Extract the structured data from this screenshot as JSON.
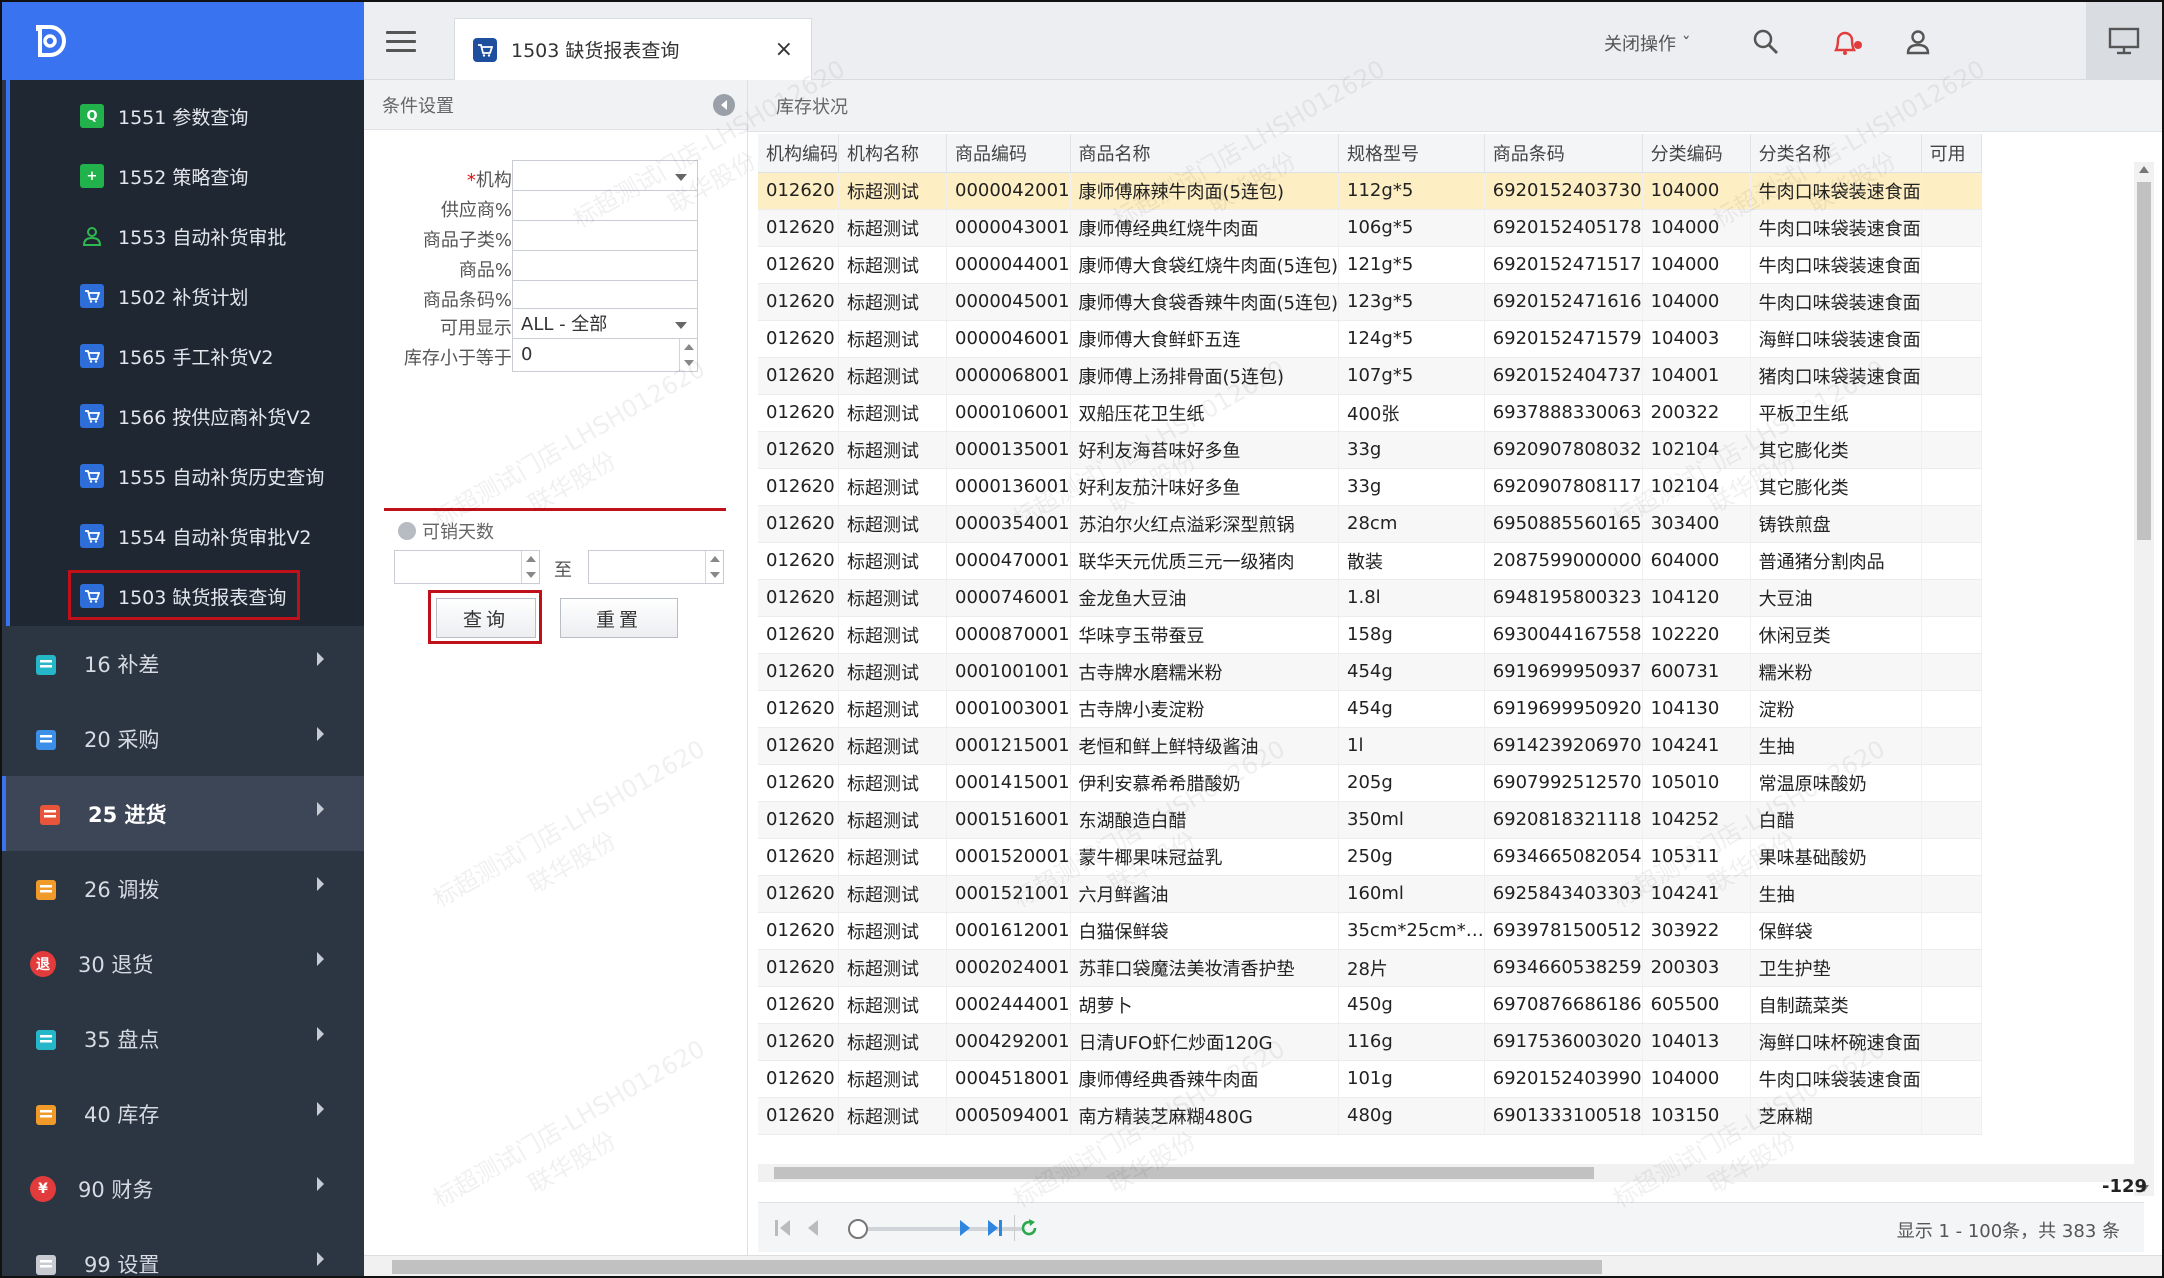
{
  "sidebar": {
    "sub_items": [
      {
        "label": "1551 参数查询",
        "icon": "search-icon",
        "color": "green"
      },
      {
        "label": "1552 策略查询",
        "icon": "plus-icon",
        "color": "green"
      },
      {
        "label": "1553 自动补货审批",
        "icon": "person-icon",
        "color": "green-outline"
      },
      {
        "label": "1502 补货计划",
        "icon": "cart-icon",
        "color": "blue"
      },
      {
        "label": "1565 手工补货V2",
        "icon": "cart-icon",
        "color": "blue"
      },
      {
        "label": "1566 按供应商补货V2",
        "icon": "cart-icon",
        "color": "blue"
      },
      {
        "label": "1555 自动补货历史查询",
        "icon": "cart-icon",
        "color": "blue"
      },
      {
        "label": "1554 自动补货审批V2",
        "icon": "cart-icon",
        "color": "blue"
      },
      {
        "label": "1503 缺货报表查询",
        "icon": "cart-icon",
        "color": "blue",
        "active": true
      }
    ],
    "main_items": [
      {
        "label": "16 补差",
        "icon": "clipboard-icon",
        "color": "#25b6c8"
      },
      {
        "label": "20 采购",
        "icon": "basket-icon",
        "color": "#3b8fe8"
      },
      {
        "label": "25 进货",
        "icon": "truck-icon",
        "color": "#e8553b",
        "active": true
      },
      {
        "label": "26 调拨",
        "icon": "transfer-icon",
        "color": "#f09a2a"
      },
      {
        "label": "30 退货",
        "icon": "return-icon",
        "color": "#e23b3b",
        "glyph": "退"
      },
      {
        "label": "35 盘点",
        "icon": "checklist-icon",
        "color": "#25b6c8"
      },
      {
        "label": "40 库存",
        "icon": "warehouse-icon",
        "color": "#f09a2a"
      },
      {
        "label": "90 财务",
        "icon": "finance-icon",
        "color": "#e23b3b",
        "glyph": "¥"
      },
      {
        "label": "99 设置",
        "icon": "gear-icon",
        "color": "#c8ccd2"
      }
    ]
  },
  "topbar": {
    "tab_label": "1503 缺货报表查询",
    "tab_close": "×",
    "close_ops": "关闭操作 ˇ"
  },
  "conditions": {
    "header": "条件设置",
    "fields": [
      {
        "label": "机构:",
        "required": true,
        "value": "",
        "type": "dropdown"
      },
      {
        "label": "供应商%:",
        "value": "",
        "type": "text"
      },
      {
        "label": "商品子类%:",
        "value": "",
        "type": "text"
      },
      {
        "label": "商品%:",
        "value": "",
        "type": "text"
      },
      {
        "label": "商品条码%:",
        "value": "",
        "type": "text"
      },
      {
        "label": "可用显示:",
        "value": "ALL - 全部",
        "type": "dropdown"
      },
      {
        "label": "库存小于等于:",
        "value": "0",
        "type": "spinner"
      }
    ],
    "required_mark": "*",
    "days_label": "可销天数",
    "to_label": "至",
    "query_button": "查询",
    "reset_button": "重置"
  },
  "stock": {
    "header": "库存状况",
    "columns": [
      "机构编码",
      "机构名称",
      "商品编码",
      "商品名称",
      "规格型号",
      "商品条码",
      "分类编码",
      "分类名称",
      "可用"
    ],
    "rows": [
      [
        "012620",
        "标超测试",
        "0000042001",
        "康师傅麻辣牛肉面(5连包)",
        "112g*5",
        "6920152403730",
        "104000",
        "牛肉口味袋装速食面"
      ],
      [
        "012620",
        "标超测试",
        "0000043001",
        "康师傅经典红烧牛肉面",
        "106g*5",
        "6920152405178",
        "104000",
        "牛肉口味袋装速食面"
      ],
      [
        "012620",
        "标超测试",
        "0000044001",
        "康师傅大食袋红烧牛肉面(5连包)",
        "121g*5",
        "6920152471517",
        "104000",
        "牛肉口味袋装速食面"
      ],
      [
        "012620",
        "标超测试",
        "0000045001",
        "康师傅大食袋香辣牛肉面(5连包)",
        "123g*5",
        "6920152471616",
        "104000",
        "牛肉口味袋装速食面"
      ],
      [
        "012620",
        "标超测试",
        "0000046001",
        "康师傅大食鲜虾五连",
        "124g*5",
        "6920152471579",
        "104003",
        "海鲜口味袋装速食面"
      ],
      [
        "012620",
        "标超测试",
        "0000068001",
        "康师傅上汤排骨面(5连包)",
        "107g*5",
        "6920152404737",
        "104001",
        "猪肉口味袋装速食面"
      ],
      [
        "012620",
        "标超测试",
        "0000106001",
        "双船压花卫生纸",
        "400张",
        "6937888330063",
        "200322",
        "平板卫生纸"
      ],
      [
        "012620",
        "标超测试",
        "0000135001",
        "好利友海苔味好多鱼",
        "33g",
        "6920907808032",
        "102104",
        "其它膨化类"
      ],
      [
        "012620",
        "标超测试",
        "0000136001",
        "好利友茄汁味好多鱼",
        "33g",
        "6920907808117",
        "102104",
        "其它膨化类"
      ],
      [
        "012620",
        "标超测试",
        "0000354001",
        "苏泊尔火红点溢彩深型煎锅",
        "28cm",
        "6950885560165",
        "303400",
        "铸铁煎盘"
      ],
      [
        "012620",
        "标超测试",
        "0000470001",
        "联华天元优质三元一级猪肉",
        "散装",
        "2087599000000",
        "604000",
        "普通猪分割肉品"
      ],
      [
        "012620",
        "标超测试",
        "0000746001",
        "金龙鱼大豆油",
        "1.8l",
        "6948195800323",
        "104120",
        "大豆油"
      ],
      [
        "012620",
        "标超测试",
        "0000870001",
        "华味亨玉带蚕豆",
        "158g",
        "6930044167558",
        "102220",
        "休闲豆类"
      ],
      [
        "012620",
        "标超测试",
        "0001001001",
        "古寺牌水磨糯米粉",
        "454g",
        "6919699950937",
        "600731",
        "糯米粉"
      ],
      [
        "012620",
        "标超测试",
        "0001003001",
        "古寺牌小麦淀粉",
        "454g",
        "6919699950920",
        "104130",
        "淀粉"
      ],
      [
        "012620",
        "标超测试",
        "0001215001",
        "老恒和鲜上鲜特级酱油",
        "1l",
        "6914239206970",
        "104241",
        "生抽"
      ],
      [
        "012620",
        "标超测试",
        "0001415001",
        "伊利安慕希希腊酸奶",
        "205g",
        "6907992512570",
        "105010",
        "常温原味酸奶"
      ],
      [
        "012620",
        "标超测试",
        "0001516001",
        "东湖酿造白醋",
        "350ml",
        "6920818321118",
        "104252",
        "白醋"
      ],
      [
        "012620",
        "标超测试",
        "0001520001",
        "蒙牛椰果味冠益乳",
        "250g",
        "6934665082054",
        "105311",
        "果味基础酸奶"
      ],
      [
        "012620",
        "标超测试",
        "0001521001",
        "六月鲜酱油",
        "160ml",
        "6925843403303",
        "104241",
        "生抽"
      ],
      [
        "012620",
        "标超测试",
        "0001612001",
        "白猫保鲜袋",
        "35cm*25cm*…",
        "6939781500512",
        "303922",
        "保鲜袋"
      ],
      [
        "012620",
        "标超测试",
        "0002024001",
        "苏菲口袋魔法美妆清香护垫",
        "28片",
        "6934660538259",
        "200303",
        "卫生护垫"
      ],
      [
        "012620",
        "标超测试",
        "0002444001",
        "胡萝卜",
        "450g",
        "6970876686186",
        "605500",
        "自制蔬菜类"
      ],
      [
        "012620",
        "标超测试",
        "0004292001",
        "日清UFO虾仁炒面120G",
        "116g",
        "6917536003020",
        "104013",
        "海鲜口味杯碗速食面"
      ],
      [
        "012620",
        "标超测试",
        "0004518001",
        "康师傅经典香辣牛肉面",
        "101g",
        "6920152403990",
        "104000",
        "牛肉口味袋装速食面"
      ],
      [
        "012620",
        "标超测试",
        "0005094001",
        "南方精装芝麻糊480G",
        "480g",
        "6901333100518",
        "103150",
        "芝麻糊"
      ]
    ],
    "footer_value": "-129",
    "pager_info": "显示 1 - 100条，共 383 条"
  },
  "colors": {
    "sidebar_bg": "#2c3542",
    "logo_bg": "#3a73f0",
    "highlight_red": "#c0101a",
    "selected_row": "#fdeec3"
  },
  "watermark": {
    "line1": "标超测试门店-LHSH012620",
    "line2": "联华股份"
  }
}
